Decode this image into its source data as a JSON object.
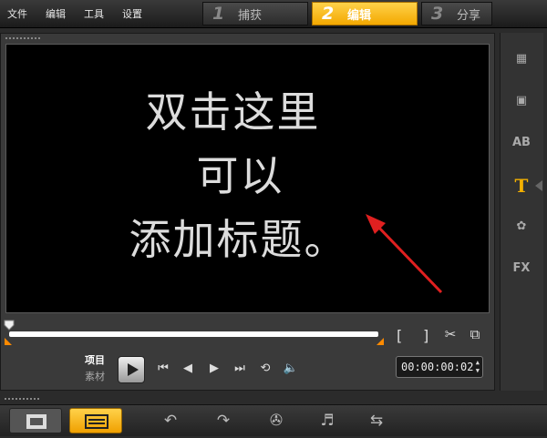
{
  "menu": [
    "文件",
    "编辑",
    "工具",
    "设置"
  ],
  "steps": [
    {
      "num": "1",
      "label": "捕获"
    },
    {
      "num": "2",
      "label": "编辑"
    },
    {
      "num": "3",
      "label": "分享"
    }
  ],
  "preview": {
    "line1": "双击这里",
    "line2": "可以",
    "line3": "添加标题。"
  },
  "markers": {
    "in": "[",
    "out": "]"
  },
  "transport": {
    "mode_project": "项目",
    "mode_clip": "素材",
    "timecode": "00:00:00:02"
  },
  "rightbar": {
    "title_tool_letter": "T",
    "text_tool_label": "AB",
    "filter_label": "FX"
  },
  "colors": {
    "accent": "#f3b000",
    "arrow": "#e02020"
  }
}
